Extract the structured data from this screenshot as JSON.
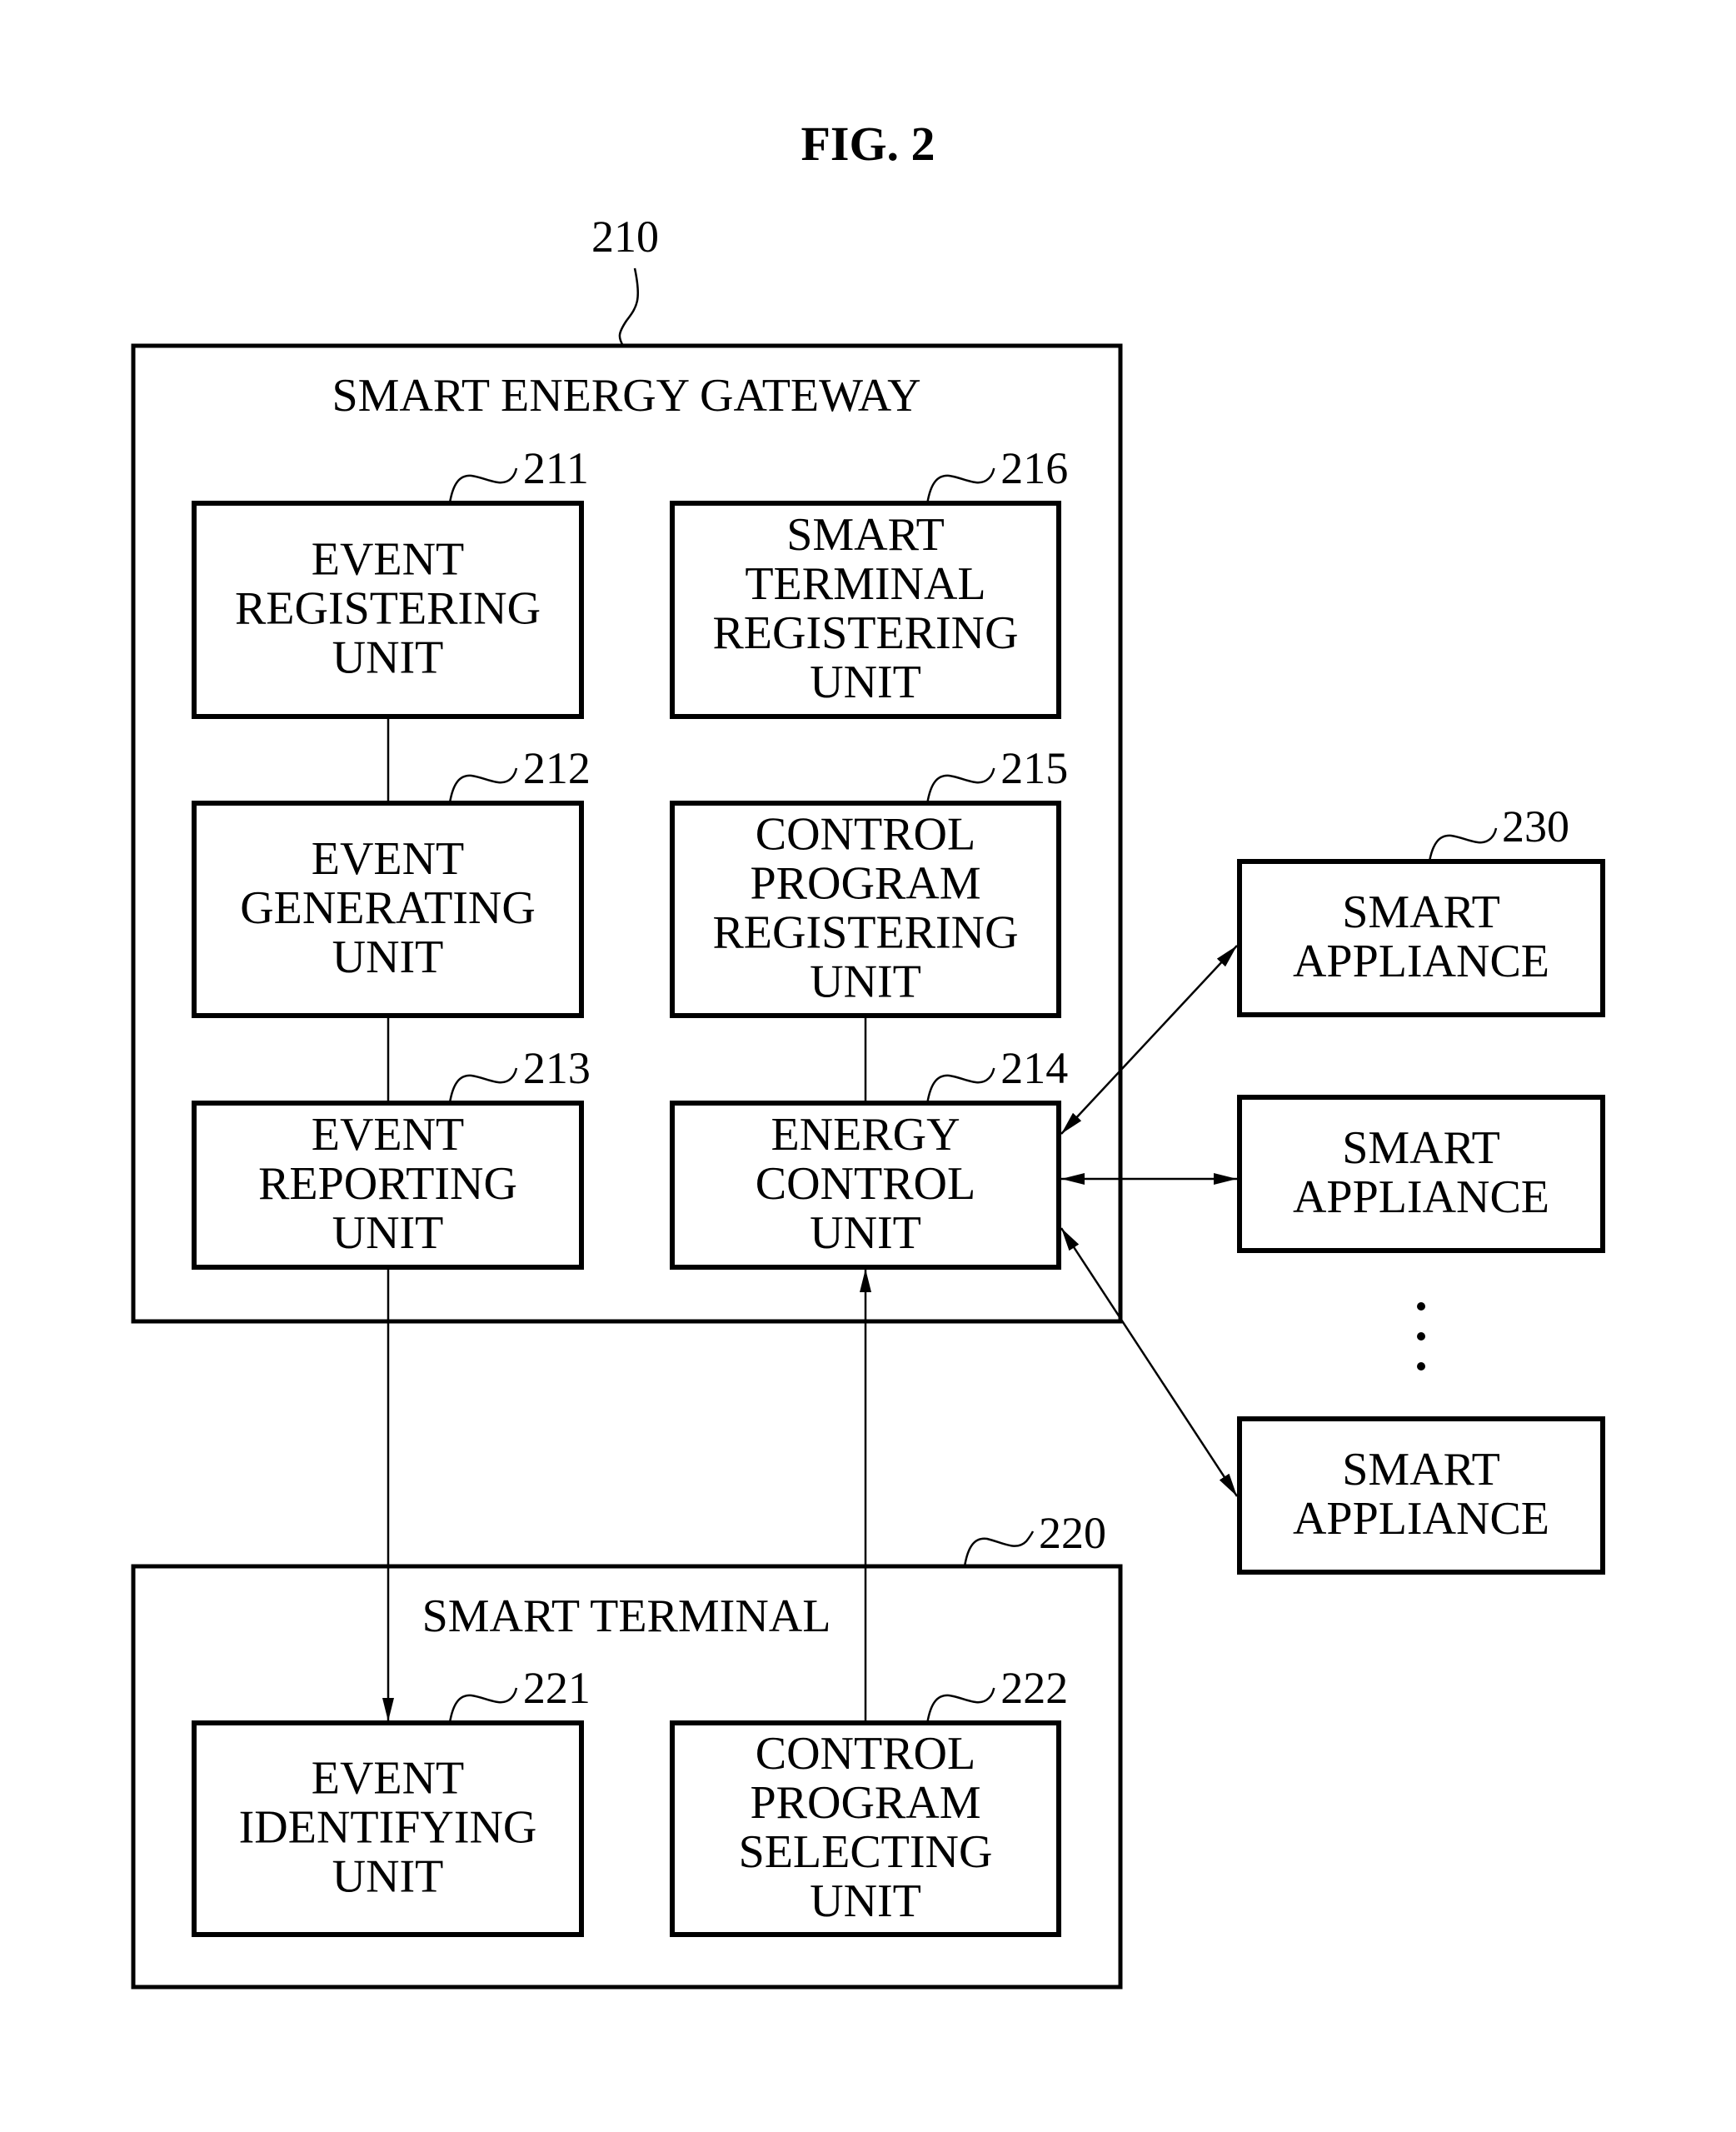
{
  "figure": {
    "title": "FIG. 2"
  },
  "gateway": {
    "ref": "210",
    "title": "SMART ENERGY GATEWAY",
    "units": [
      {
        "id": "211",
        "ref": "211",
        "lines": [
          "EVENT",
          "REGISTERING",
          "UNIT"
        ]
      },
      {
        "id": "216",
        "ref": "216",
        "lines": [
          "SMART",
          "TERMINAL",
          "REGISTERING",
          "UNIT"
        ]
      },
      {
        "id": "212",
        "ref": "212",
        "lines": [
          "EVENT",
          "GENERATING",
          "UNIT"
        ]
      },
      {
        "id": "215",
        "ref": "215",
        "lines": [
          "CONTROL",
          "PROGRAM",
          "REGISTERING",
          "UNIT"
        ]
      },
      {
        "id": "213",
        "ref": "213",
        "lines": [
          "EVENT",
          "REPORTING",
          "UNIT"
        ]
      },
      {
        "id": "214",
        "ref": "214",
        "lines": [
          "ENERGY",
          "CONTROL",
          "UNIT"
        ]
      }
    ]
  },
  "terminal": {
    "ref": "220",
    "title": "SMART TERMINAL",
    "units": [
      {
        "id": "221",
        "ref": "221",
        "lines": [
          "EVENT",
          "IDENTIFYING",
          "UNIT"
        ]
      },
      {
        "id": "222",
        "ref": "222",
        "lines": [
          "CONTROL",
          "PROGRAM",
          "SELECTING",
          "UNIT"
        ]
      }
    ]
  },
  "appliances": {
    "ref": "230",
    "items": [
      {
        "lines": [
          "SMART",
          "APPLIANCE"
        ]
      },
      {
        "lines": [
          "SMART",
          "APPLIANCE"
        ]
      },
      {
        "lines": [
          "SMART",
          "APPLIANCE"
        ]
      }
    ],
    "ellipsis": "⋮"
  }
}
